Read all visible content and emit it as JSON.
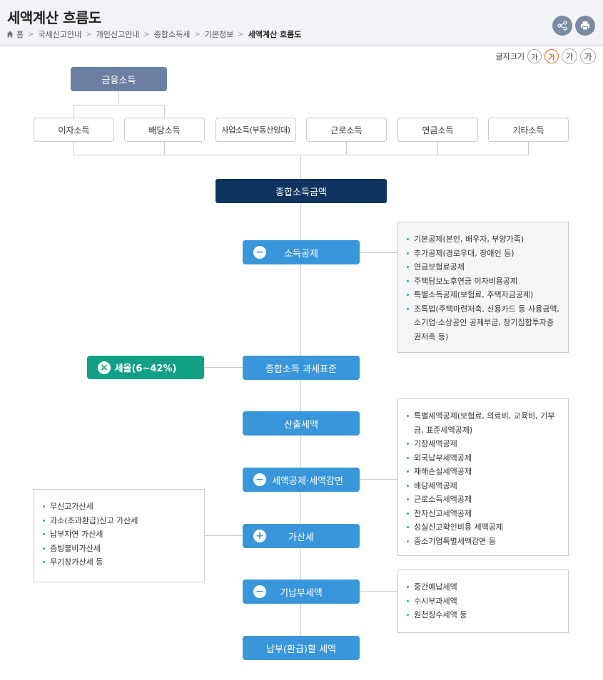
{
  "header": {
    "title": "세액계산 흐름도",
    "breadcrumb": [
      "홈",
      "국세신고안내",
      "개인신고안내",
      "종합소득세",
      "기본정보",
      "세액계산 흐름도"
    ]
  },
  "actions": {
    "share_icon": "share-icon",
    "print_icon": "print-icon"
  },
  "font_size": {
    "label": "글자크기",
    "options": [
      "가",
      "가",
      "가",
      "가"
    ],
    "active_index": 1
  },
  "flow": {
    "financial_income": "금융소득",
    "income_types": [
      "이자소득",
      "배당소득",
      "사업소득(부동산임대)",
      "근로소득",
      "연금소득",
      "기타소득"
    ],
    "total_income": "종합소득금액",
    "income_deduction": {
      "symbol": "−",
      "label": "소득공제"
    },
    "tax_base": "종합소득 과세표준",
    "tax_rate": {
      "symbol": "×",
      "label": "세율(6~42%)"
    },
    "calculated_tax": "산출세액",
    "tax_credit": {
      "symbol": "−",
      "label": "세액공제·세액감면"
    },
    "penalty_tax": {
      "symbol": "+",
      "label": "가산세"
    },
    "prepaid_tax": {
      "symbol": "−",
      "label": "기납부세액"
    },
    "final_tax": "납부(환급)할 세액"
  },
  "deduction_items": [
    "기본공제(본인, 배우자, 부양가족)",
    "추가공제(경로우대, 장애인 등)",
    "연금보험료공제",
    "주택담보노후연금 이자비용공제",
    "특별소득공제(보험료, 주택자금공제)",
    "조특법(주택마련저축, 신용카드 등 사용금액, 소기업·소상공인 공제부금, 장기집합투자증권저축 등)"
  ],
  "credit_items": [
    "특별세액공제(보험료, 의료비, 교육비, 기부금, 표준세액공제)",
    "기장세액공제",
    "외국납부세액공제",
    "재해손실세액공제",
    "배당세액공제",
    "근로소득세액공제",
    "전자신고세액공제",
    "성실신고확인비용 세액공제",
    "중소기업특별세액감면 등"
  ],
  "penalty_items": [
    "무신고가산세",
    "과소(초과환급)신고 가산세",
    "납부지연 가산세",
    "증빙불비가산세",
    "무기장가산세 등"
  ],
  "prepaid_items": [
    "중간예납세액",
    "수시부과세액",
    "원천징수세액 등"
  ],
  "colors": {
    "navy": "#0f3460",
    "slate": "#6b7fa3",
    "blue": "#3996db",
    "green": "#12a085",
    "accent": "#e8701a"
  }
}
